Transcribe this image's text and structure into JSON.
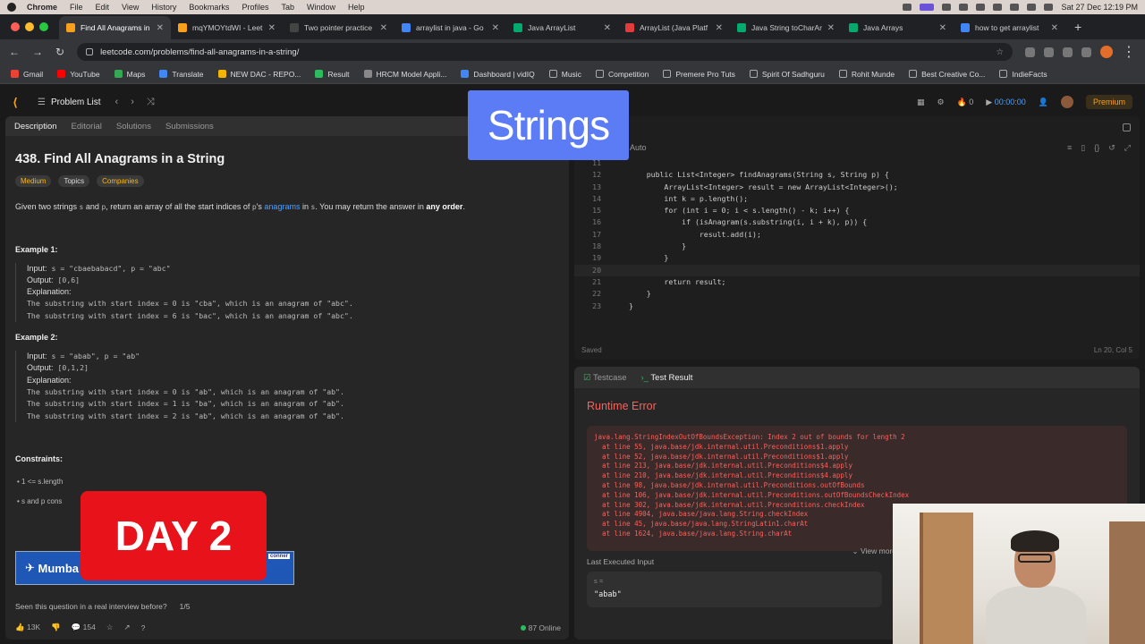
{
  "menubar": {
    "items": [
      "Chrome",
      "File",
      "Edit",
      "View",
      "History",
      "Bookmarks",
      "Profiles",
      "Tab",
      "Window",
      "Help"
    ],
    "datetime": "Sat 27 Dec 12:19 PM"
  },
  "tabs": [
    {
      "title": "Find All Anagrams in",
      "active": true,
      "color": "#f89f1b"
    },
    {
      "title": "mqYMOYtdWI - Leet",
      "active": false,
      "color": "#f89f1b"
    },
    {
      "title": "Two pointer practice",
      "active": false,
      "color": "#444444"
    },
    {
      "title": "arraylist in java - Go",
      "active": false,
      "color": "#4285f4"
    },
    {
      "title": "Java ArrayList",
      "active": false,
      "color": "#04aa6d"
    },
    {
      "title": "ArrayList (Java Platf",
      "active": false,
      "color": "#e23b3b"
    },
    {
      "title": "Java String toCharAr",
      "active": false,
      "color": "#04aa6d"
    },
    {
      "title": "Java Arrays",
      "active": false,
      "color": "#04aa6d"
    },
    {
      "title": "how to get arraylist",
      "active": false,
      "color": "#4285f4"
    }
  ],
  "address": {
    "url": "leetcode.com/problems/find-all-anagrams-in-a-string/"
  },
  "bookmarks": [
    {
      "label": "Gmail",
      "color": "#ea4335"
    },
    {
      "label": "YouTube",
      "color": "#ff0000"
    },
    {
      "label": "Maps",
      "color": "#34a853"
    },
    {
      "label": "Translate",
      "color": "#4285f4"
    },
    {
      "label": "NEW DAC - REPO...",
      "color": "#f4b400"
    },
    {
      "label": "Result",
      "color": "#2cbb5d"
    },
    {
      "label": "HRCM Model Appli...",
      "color": "#888888"
    },
    {
      "label": "Dashboard | vidIQ",
      "color": "#4285f4"
    },
    {
      "label": "Music",
      "color": "#888888"
    },
    {
      "label": "Competition",
      "color": "#888888"
    },
    {
      "label": "Premere Pro Tuts",
      "color": "#888888"
    },
    {
      "label": "Spirit Of Sadhguru",
      "color": "#888888"
    },
    {
      "label": "Rohit Munde",
      "color": "#888888"
    },
    {
      "label": "Best Creative Co...",
      "color": "#888888"
    },
    {
      "label": "IndieFacts",
      "color": "#888888"
    }
  ],
  "lcheader": {
    "problem_list": "Problem List",
    "timer": "00:00:00",
    "streak": "0",
    "premium": "Premium"
  },
  "left_tabs": [
    "Description",
    "Editorial",
    "Solutions",
    "Submissions"
  ],
  "problem": {
    "title": "438. Find All Anagrams in a String",
    "difficulty": "Medium",
    "topics": "Topics",
    "companies": "Companies",
    "stmt_1": "Given two strings",
    "stmt_s": "s",
    "stmt_and": "and",
    "stmt_p": "p",
    "stmt_2": ", return an array of all the start indices of",
    "stmt_p2": "p",
    "stmt_3": "'s",
    "stmt_link": "anagrams",
    "stmt_4": "in",
    "stmt_s2": "s",
    "stmt_5": ". You may return the answer in",
    "stmt_bold": "any order",
    "stmt_6": "."
  },
  "example1": {
    "heading": "Example 1:",
    "input": "s = \"cbaebabacd\", p = \"abc\"",
    "output": "[0,6]",
    "line1": "The substring with start index = 0 is \"cba\", which is an anagram of \"abc\".",
    "line2": "The substring with start index = 6 is \"bac\", which is an anagram of \"abc\"."
  },
  "example2": {
    "heading": "Example 2:",
    "input": "s = \"abab\", p = \"ab\"",
    "output": "[0,1,2]",
    "line1": "The substring with start index = 0 is \"ab\", which is an anagram of \"ab\".",
    "line2": "The substring with start index = 1 is \"ba\", which is an anagram of \"ab\".",
    "line3": "The substring with start index = 2 is \"ab\", which is an anagram of \"ab\"."
  },
  "labels": {
    "input": "Input:",
    "output": "Output:",
    "explanation": "Explanation:"
  },
  "constraints": {
    "heading": "Constraints:",
    "c1": "1 <= s.length",
    "c2": "s and p cons"
  },
  "ad": {
    "text": "Mumba",
    "badge": "conner"
  },
  "seen": {
    "question": "Seen this question in a real interview before?",
    "pager": "1/5"
  },
  "footer": {
    "likes": "13K",
    "comments": "154",
    "online": "87 Online"
  },
  "overlays": {
    "top": "Strings",
    "bottom": "DAY 2"
  },
  "editor": {
    "lang": "Auto",
    "saved": "Saved",
    "cursor": "Ln 20, Col 5",
    "lines": [
      {
        "n": "11",
        "t": ""
      },
      {
        "n": "12",
        "t": "    public List<Integer> findAnagrams(String s, String p) {"
      },
      {
        "n": "13",
        "t": "        ArrayList<Integer> result = new ArrayList<Integer>();"
      },
      {
        "n": "14",
        "t": "        int k = p.length();"
      },
      {
        "n": "15",
        "t": "        for (int i = 0; i < s.length() - k; i++) {"
      },
      {
        "n": "16",
        "t": "            if (isAnagram(s.substring(i, i + k), p)) {"
      },
      {
        "n": "17",
        "t": "                result.add(i);"
      },
      {
        "n": "18",
        "t": "            }"
      },
      {
        "n": "19",
        "t": "        }"
      },
      {
        "n": "20",
        "t": ""
      },
      {
        "n": "21",
        "t": "        return result;"
      },
      {
        "n": "22",
        "t": "    }"
      },
      {
        "n": "23",
        "t": "}"
      }
    ]
  },
  "test": {
    "tabs": [
      "Testcase",
      "Test Result"
    ],
    "status": "Runtime Error",
    "exception": "java.lang.StringIndexOutOfBoundsException: Index 2 out of bounds for length 2",
    "stack": [
      "at line 55, java.base/jdk.internal.util.Preconditions$1.apply",
      "at line 52, java.base/jdk.internal.util.Preconditions$1.apply",
      "at line 213, java.base/jdk.internal.util.Preconditions$4.apply",
      "at line 210, java.base/jdk.internal.util.Preconditions$4.apply",
      "at line 98, java.base/jdk.internal.util.Preconditions.outOfBounds",
      "at line 106, java.base/jdk.internal.util.Preconditions.outOfBoundsCheckIndex",
      "at line 302, java.base/jdk.internal.util.Preconditions.checkIndex",
      "at line 4904, java.base/java.lang.String.checkIndex",
      "at line 45, java.base/java.lang.StringLatin1.charAt",
      "at line 1624, java.base/java.lang.String.charAt"
    ],
    "view_more": "View more",
    "last_input_label": "Last Executed Input",
    "var_label": "s =",
    "var_value": "\"abab\""
  }
}
